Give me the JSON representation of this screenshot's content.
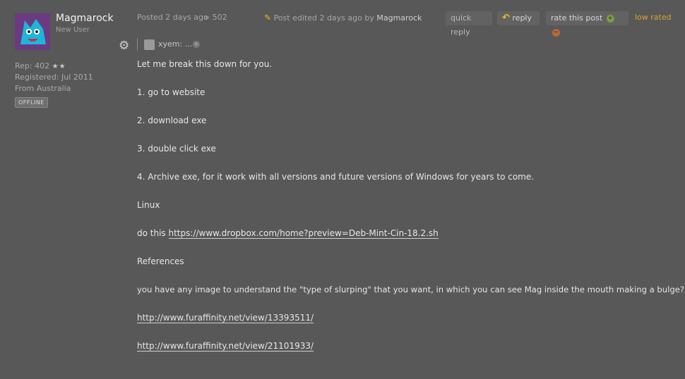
{
  "user": {
    "name": "Magmarock",
    "title": "New User",
    "rep_label": "Rep: 402",
    "rep_stars": "★★",
    "registered": "Registered: Jul 2011",
    "location": "From Australia",
    "status": "OFFLINE"
  },
  "post": {
    "posted_prefix": "Posted",
    "posted_time": "2 days ago",
    "views": "502",
    "edited_prefix": "Post edited",
    "edited_time": "2 days ago",
    "edited_by_prefix": "by",
    "edited_by": "Magmarock"
  },
  "actions": {
    "quick_reply": "quick reply",
    "reply": "reply",
    "rate": "rate this post",
    "rating_status": "low rated"
  },
  "rep_row": {
    "user": "xyem: ..."
  },
  "body": {
    "intro": "Let me break this down for you.",
    "step1": "1. go to website",
    "step2": "2. download exe",
    "step3": "3. double click exe",
    "step4": "4. Archive exe, for it work with all versions and future versions of Windows for years to come.",
    "linux": "Linux",
    "do_this": "do this",
    "link1": "https://www.dropbox.com/home?preview=Deb-Mint-Cin-18.2.sh",
    "references": "References",
    "question": "you have any image to understand the \"type of slurping\" that you want, in which you can see Mag inside the mouth making a bulge?",
    "link2": "http://www.furaffinity.net/view/13393511/",
    "link3": "http://www.furaffinity.net/view/21101933/"
  },
  "colors": {
    "background": "#585858",
    "accent_low_rated": "#e0a030",
    "reply_arrow": "#f0c020"
  },
  "icons": [
    "avatar-image",
    "views-icon",
    "pencil-icon",
    "reply-arrow-icon",
    "plus-icon",
    "minus-icon",
    "gear-icon",
    "mini-avatar",
    "more-icon"
  ]
}
